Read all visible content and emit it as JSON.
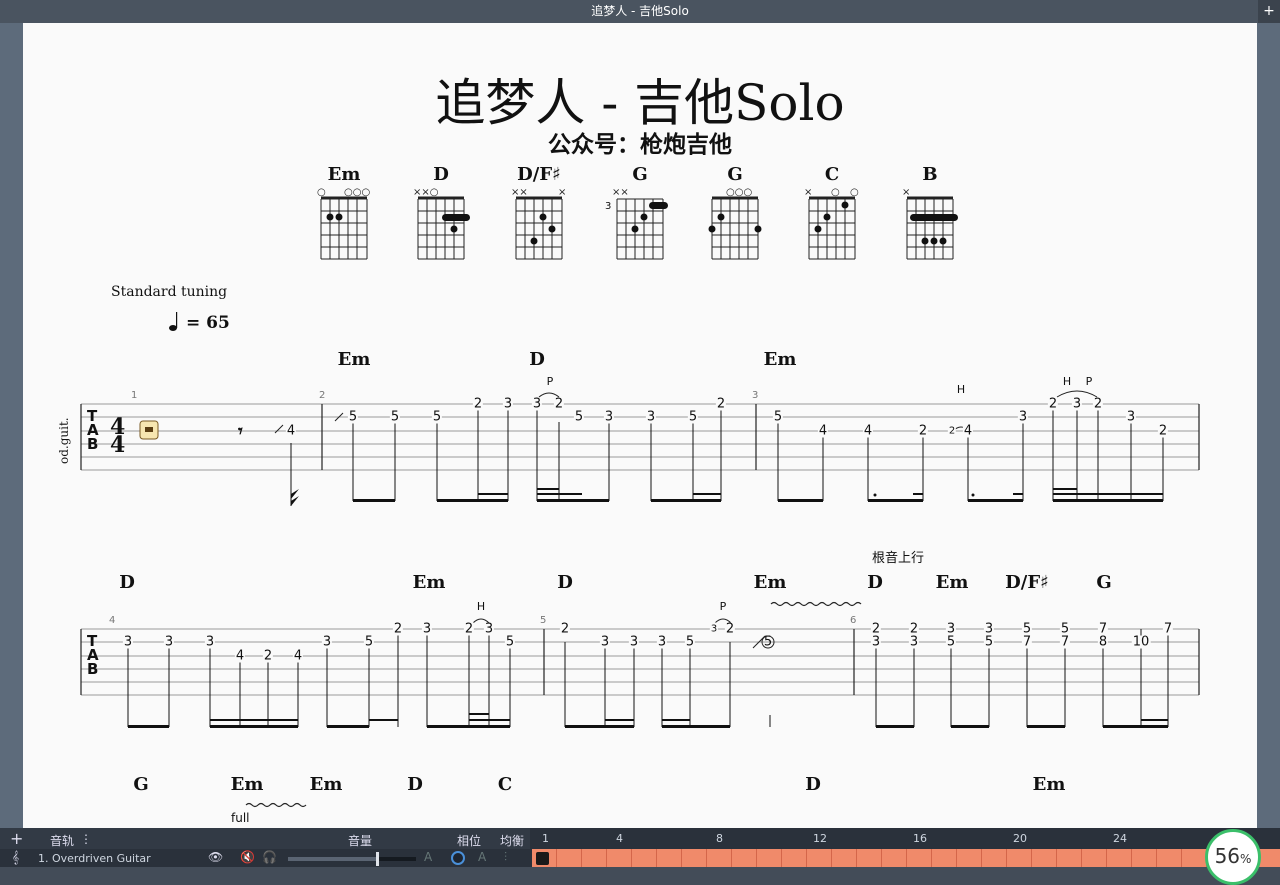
{
  "window": {
    "title": "追梦人 - 吉他Solo",
    "add_label": "+"
  },
  "score": {
    "title": "追梦人 - 吉他Solo",
    "subtitle": "公众号：枪炮吉他",
    "tuning": "Standard tuning",
    "tempo": "= 65",
    "instrument": "od.guit.",
    "chord_diagrams": [
      "Em",
      "D",
      "D/F♯",
      "G",
      "G",
      "C",
      "B"
    ],
    "chord_fret_label": "3",
    "system1": {
      "chords": [
        "Em",
        "D",
        "Em"
      ],
      "bar_numbers": [
        "1",
        "2",
        "3"
      ],
      "tech": [
        "P",
        "H",
        "H",
        "P"
      ]
    },
    "system2": {
      "chords": [
        "D",
        "Em",
        "D",
        "Em",
        "D",
        "Em",
        "D/F♯",
        "G"
      ],
      "bar_numbers": [
        "4",
        "5",
        "6"
      ],
      "tech": [
        "H",
        "P"
      ],
      "annotation": "根音上行"
    },
    "system3": {
      "chords": [
        "G",
        "Em",
        "Em",
        "D",
        "C",
        "D",
        "Em"
      ],
      "bend": "full"
    }
  },
  "tracks": {
    "header_label": "音轨",
    "volume_label": "音量",
    "phase_label": "相位",
    "balance_label": "均衡",
    "track_name": "1. Overdriven Guitar",
    "ruler": [
      "1",
      "4",
      "8",
      "12",
      "16",
      "20",
      "24"
    ]
  },
  "zoom": {
    "value": "56",
    "unit": "%"
  }
}
